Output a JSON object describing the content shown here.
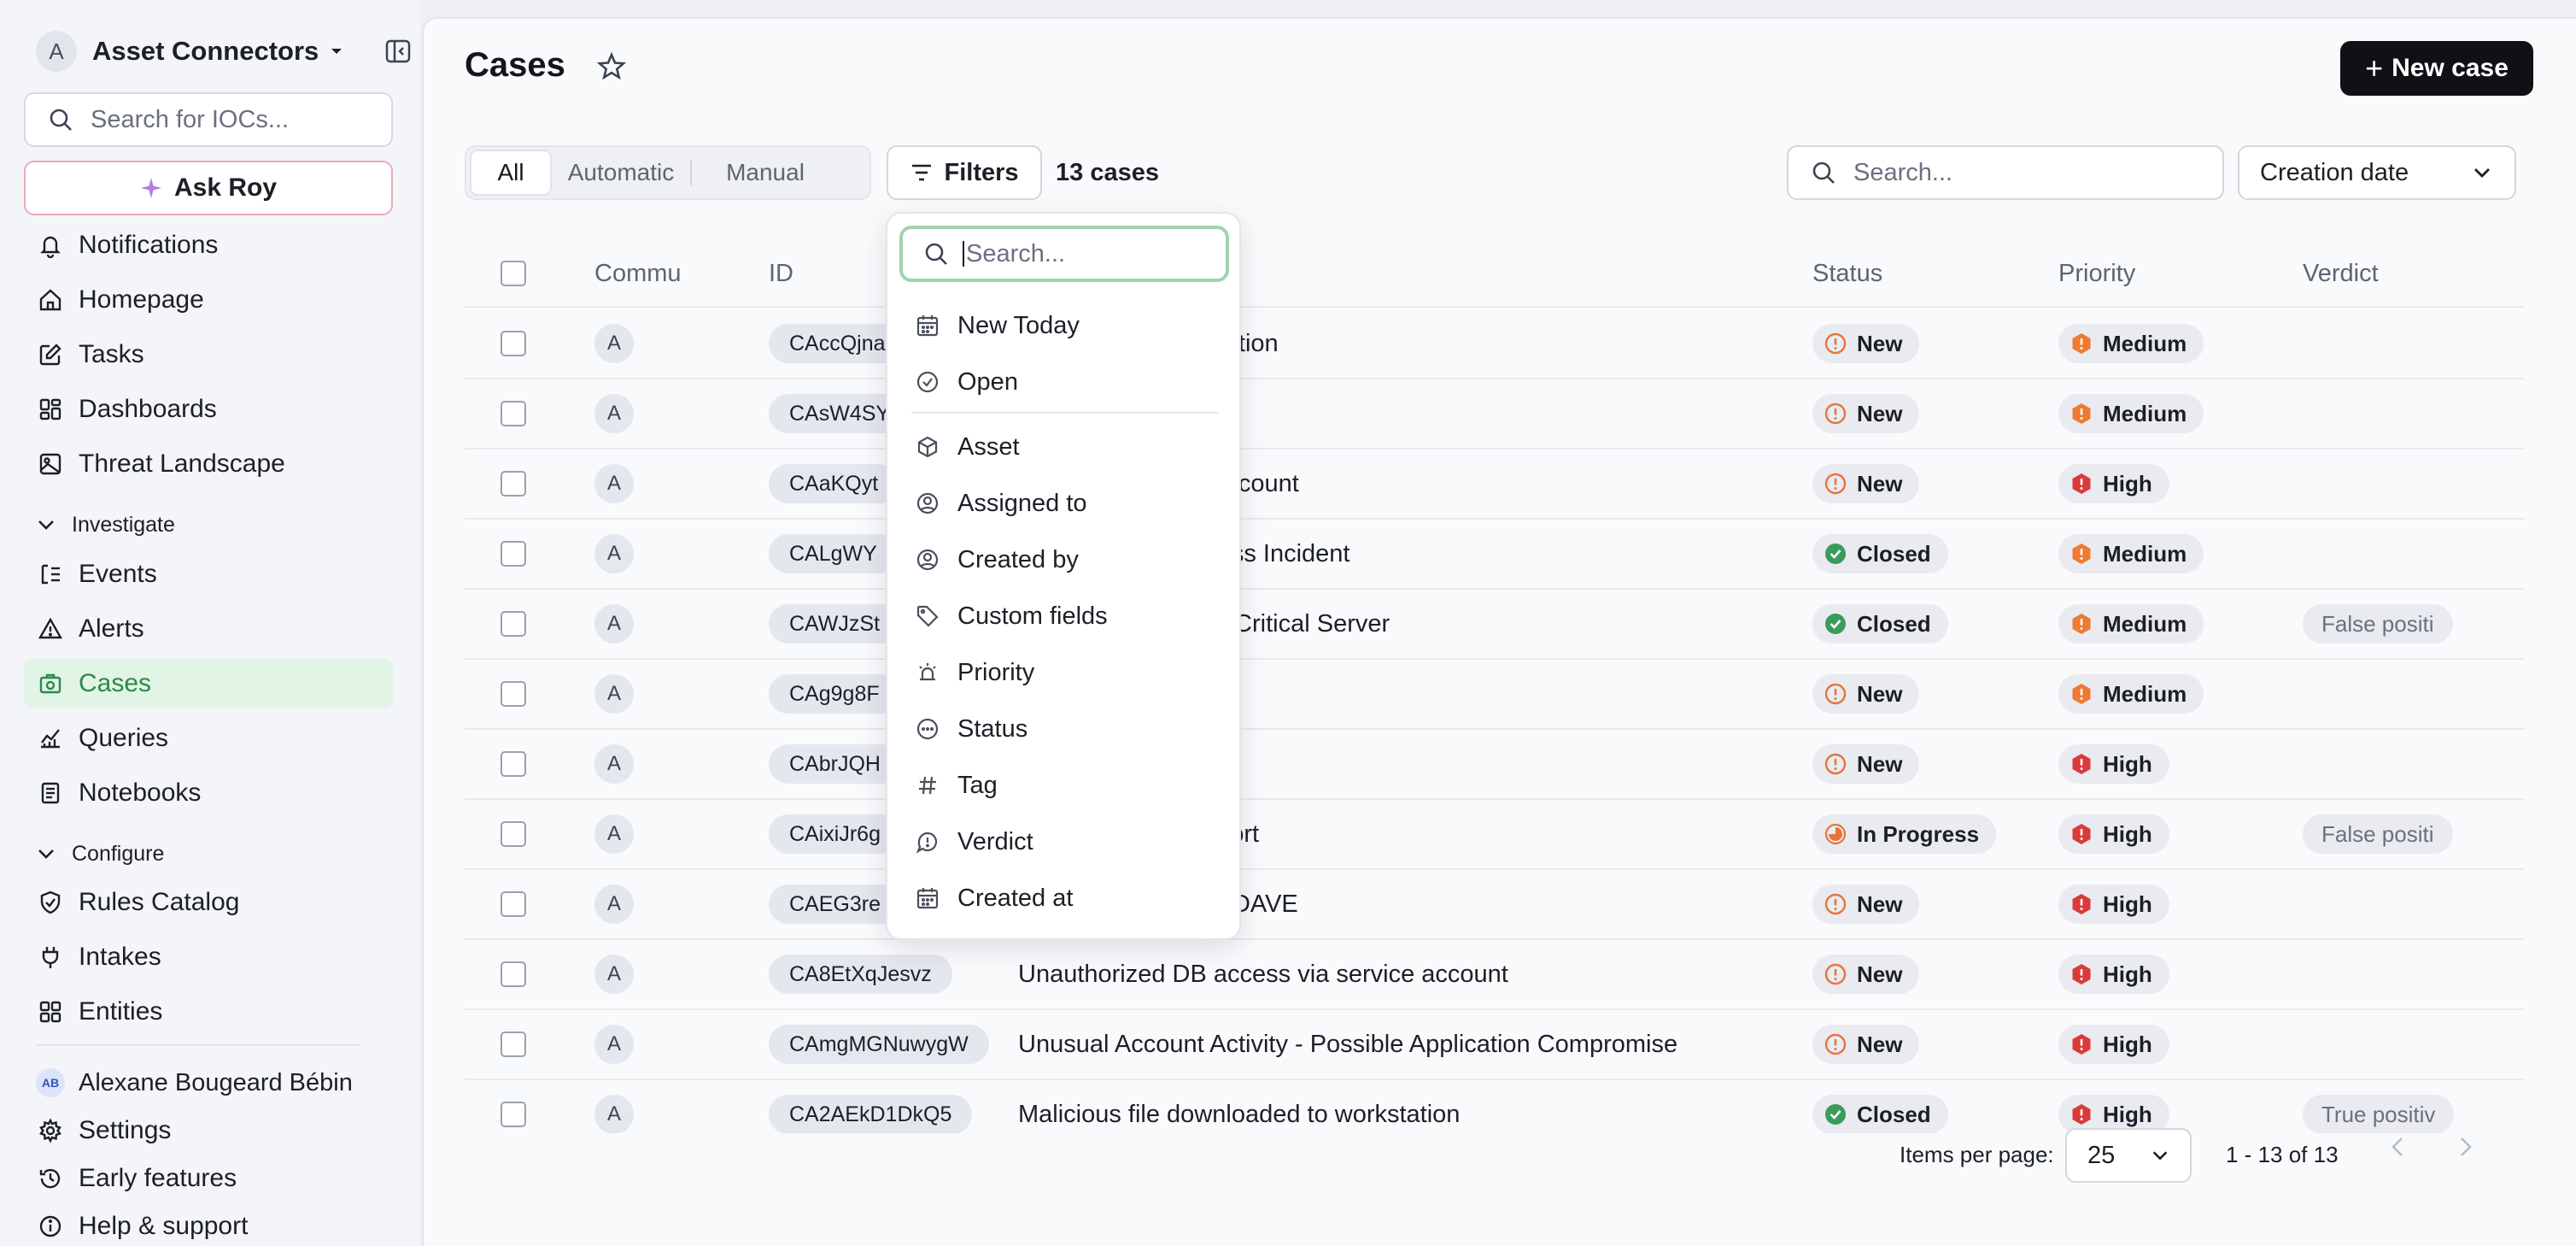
{
  "sidebar": {
    "workspace": {
      "avatar": "A",
      "name": "Asset Connectors"
    },
    "search_placeholder": "Search for IOCs...",
    "ask_label": "Ask Roy",
    "nav_top": [
      {
        "label": "Notifications",
        "icon": "bell-icon"
      },
      {
        "label": "Homepage",
        "icon": "home-icon"
      },
      {
        "label": "Tasks",
        "icon": "edit-icon"
      },
      {
        "label": "Dashboards",
        "icon": "dashboard-icon"
      },
      {
        "label": "Threat Landscape",
        "icon": "image-icon"
      }
    ],
    "investigate": {
      "title": "Investigate",
      "items": [
        {
          "label": "Events",
          "icon": "events-icon"
        },
        {
          "label": "Alerts",
          "icon": "alert-triangle-icon"
        },
        {
          "label": "Cases",
          "icon": "cases-icon",
          "active": true
        },
        {
          "label": "Queries",
          "icon": "queries-icon"
        },
        {
          "label": "Notebooks",
          "icon": "notebook-icon"
        }
      ]
    },
    "configure": {
      "title": "Configure",
      "items": [
        {
          "label": "Rules Catalog",
          "icon": "shield-icon"
        },
        {
          "label": "Intakes",
          "icon": "plug-icon"
        },
        {
          "label": "Entities",
          "icon": "entities-icon"
        }
      ]
    },
    "user": {
      "initials": "AB",
      "name": "Alexane Bougeard Bébin"
    },
    "bottom": [
      {
        "label": "Settings",
        "icon": "gear-icon"
      },
      {
        "label": "Early features",
        "icon": "history-icon"
      },
      {
        "label": "Help & support",
        "icon": "info-icon"
      }
    ]
  },
  "header": {
    "title": "Cases",
    "new_case_label": "New case"
  },
  "toolbar": {
    "tabs": [
      "All",
      "Automatic",
      "Manual"
    ],
    "active_tab": "All",
    "filters_label": "Filters",
    "count_label": "13 cases",
    "search_placeholder": "Search...",
    "sort_value": "Creation date"
  },
  "table": {
    "columns": {
      "community": "Commu",
      "id": "ID",
      "status": "Status",
      "priority": "Priority",
      "verdict": "Verdict"
    },
    "rows": [
      {
        "avatar": "A",
        "id": "CAccQjna",
        "title": "movement investigation",
        "status": "New",
        "priority": "Medium",
        "verdict": ""
      },
      {
        "avatar": "A",
        "id": "CAsW4SY",
        "title": "",
        "status": "New",
        "priority": "Medium",
        "verdict": ""
      },
      {
        "avatar": "A",
        "id": "CAaKQyt",
        "title": "ccess via service account",
        "status": "New",
        "priority": "High",
        "verdict": ""
      },
      {
        "avatar": "A",
        "id": "CALgWY",
        "title": "g & Privileged Access Incident",
        "status": "Closed",
        "priority": "Medium",
        "verdict": ""
      },
      {
        "avatar": "A",
        "id": "CAWJzSt",
        "title": "on Compromise on Critical Server",
        "status": "Closed",
        "priority": "Medium",
        "verdict": "False positi"
      },
      {
        "avatar": "A",
        "id": "CAg9g8F",
        "title": "",
        "status": "New",
        "priority": "Medium",
        "verdict": ""
      },
      {
        "avatar": "A",
        "id": "CAbrJQH",
        "title": "",
        "status": "New",
        "priority": "High",
        "verdict": ""
      },
      {
        "avatar": "A",
        "id": "CAixiJr6g",
        "title": "omise Incident Report",
        "status": "In Progress",
        "priority": "High",
        "verdict": "False positi"
      },
      {
        "avatar": "A",
        "id": "CAEG3re",
        "title": "loaded to LAPTOP-DAVE",
        "status": "New",
        "priority": "High",
        "verdict": ""
      },
      {
        "avatar": "A",
        "id": "CA8EtXqJesvz",
        "title": "Unauthorized DB access via service account",
        "status": "New",
        "priority": "High",
        "verdict": ""
      },
      {
        "avatar": "A",
        "id": "CAmgMGNuwygW",
        "title": "Unusual Account Activity - Possible Application Compromise",
        "status": "New",
        "priority": "High",
        "verdict": ""
      },
      {
        "avatar": "A",
        "id": "CA2AEkD1DkQ5",
        "title": "Malicious file downloaded to workstation",
        "status": "Closed",
        "priority": "High",
        "verdict": "True positiv"
      }
    ]
  },
  "footer": {
    "items_per_page_label": "Items per page:",
    "items_per_page_value": "25",
    "range_label": "1 - 13 of 13"
  },
  "filter_menu": {
    "search_placeholder": "Search...",
    "quick": [
      {
        "label": "New Today",
        "icon": "calendar-icon"
      },
      {
        "label": "Open",
        "icon": "check-circle-icon"
      }
    ],
    "fields": [
      {
        "label": "Asset",
        "icon": "cube-icon"
      },
      {
        "label": "Assigned to",
        "icon": "user-circle-icon"
      },
      {
        "label": "Created by",
        "icon": "user-circle-icon"
      },
      {
        "label": "Custom fields",
        "icon": "tag-icon"
      },
      {
        "label": "Priority",
        "icon": "siren-icon"
      },
      {
        "label": "Status",
        "icon": "dots-circle-icon"
      },
      {
        "label": "Tag",
        "icon": "hash-icon"
      },
      {
        "label": "Verdict",
        "icon": "chat-icon"
      },
      {
        "label": "Created at",
        "icon": "calendar-icon"
      }
    ]
  },
  "colors": {
    "active_nav_bg": "#e2f4e6",
    "active_nav_text": "#2b8a4a",
    "status_new": "#e8743b",
    "status_closed": "#3a9b5a",
    "priority_medium": "#ee7a34",
    "priority_high": "#d93b3b",
    "primary_button": "#0f1115"
  }
}
